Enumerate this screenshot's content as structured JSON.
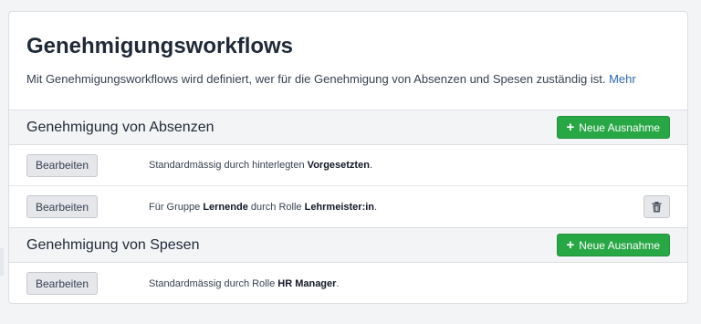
{
  "header": {
    "title": "Genehmigungsworkflows",
    "description": "Mit Genehmigungsworkflows wird definiert, wer für die Genehmigung von Absenzen und Spesen zuständig ist.",
    "more_link": "Mehr"
  },
  "sections": [
    {
      "title": "Genehmigung von Absenzen",
      "add_button": "Neue Ausnahme",
      "rows": [
        {
          "edit_label": "Bearbeiten",
          "prefix": "Standardmässig durch hinterlegten",
          "bold1": "Vorgesetzten",
          "suffix": "."
        },
        {
          "edit_label": "Bearbeiten",
          "prefix": "Für Gruppe",
          "bold1": "Lernende",
          "middle": "durch Rolle",
          "bold2": "Lehrmeister:in",
          "suffix": "."
        }
      ]
    },
    {
      "title": "Genehmigung von Spesen",
      "add_button": "Neue Ausnahme",
      "rows": [
        {
          "edit_label": "Bearbeiten",
          "prefix": "Standardmässig durch Rolle",
          "bold1": "HR Manager",
          "suffix": "."
        }
      ]
    }
  ],
  "icons": {
    "add": "plus-icon",
    "delete": "trash-icon"
  },
  "colors": {
    "primary_green": "#28a745",
    "link_blue": "#2b6cb0",
    "section_bg": "#f3f4f6"
  }
}
